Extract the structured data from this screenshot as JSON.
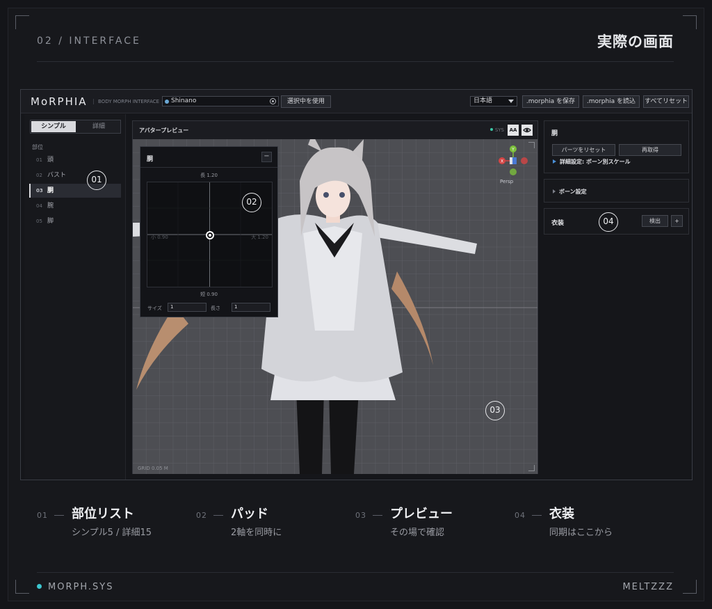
{
  "header": {
    "section_tag": "02 / INTERFACE",
    "title": "実際の画面"
  },
  "app": {
    "logo": "MoRPHIA",
    "logo_sub": "BODY MORPH INTERFACE",
    "avatar_value": "Shinano",
    "use_selected_label": "選択中を使用",
    "language": "日本語",
    "save_label": ".morphia を保存",
    "load_label": ".morphia を読込",
    "reset_all_label": "すべてリセット"
  },
  "sidebar": {
    "mode_simple": "シンプル",
    "mode_detail": "詳細",
    "heading": "部位",
    "items": [
      {
        "num": "01",
        "label": "頭"
      },
      {
        "num": "02",
        "label": "バスト"
      },
      {
        "num": "03",
        "label": "胴"
      },
      {
        "num": "04",
        "label": "腕"
      },
      {
        "num": "05",
        "label": "脚"
      }
    ],
    "selected_index": 2
  },
  "preview": {
    "title": "アバタープレビュー",
    "sys_label": "SYS",
    "aa_label": "AA",
    "grid_label": "GRID 0.05 M",
    "gizmo_view": "Persp",
    "gizmo_axes": {
      "y": "Y",
      "x": "X"
    }
  },
  "pad": {
    "title": "胴",
    "min_label": "−",
    "top_label": "長 1.20",
    "bottom_label": "短 0.90",
    "left_label": "小 0.90",
    "right_label": "大 1.20",
    "size_label": "サイズ",
    "size_value": "1",
    "length_label": "長さ",
    "length_value": "1"
  },
  "right_panel": {
    "part_title": "胴",
    "reset_parts_label": "パーツをリセット",
    "reacquire_label": "再取得",
    "advanced_link": "詳細設定: ボーン別スケール",
    "bone_settings": "ボーン設定",
    "outfit_title": "衣装",
    "detect_label": "検出",
    "add_label": "+"
  },
  "callouts": [
    "01",
    "02",
    "03",
    "04"
  ],
  "legend": [
    {
      "num": "01",
      "title": "部位リスト",
      "sub": "シンプル5 / 詳細15"
    },
    {
      "num": "02",
      "title": "パッド",
      "sub": "2軸を同時に"
    },
    {
      "num": "03",
      "title": "プレビュー",
      "sub": "その場で確認"
    },
    {
      "num": "04",
      "title": "衣装",
      "sub": "同期はここから"
    }
  ],
  "footer": {
    "left": "MORPH.SYS",
    "right": "MELTZZZ"
  },
  "colors": {
    "accent_teal": "#3cc6cf",
    "status_green": "#3cc6a6",
    "link_blue": "#4a8fd6",
    "background": "#141519"
  }
}
